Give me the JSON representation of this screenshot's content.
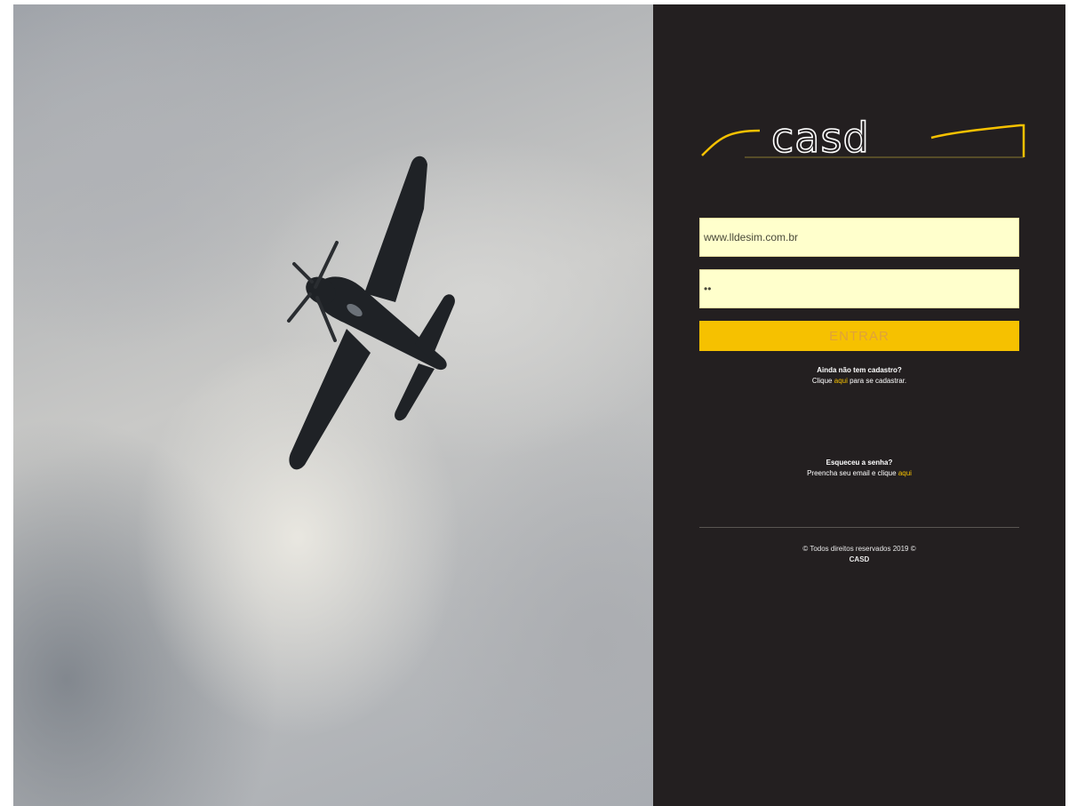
{
  "brand": {
    "logo_text": "casd",
    "accent_color": "#f6c100",
    "panel_color": "#231f20"
  },
  "login": {
    "email_value": "www.lldesim.com.br",
    "password_value": "••",
    "submit_label": "ENTRAR"
  },
  "signup": {
    "question": "Ainda não tem cadastro?",
    "prefix": "Clique",
    "link": "aqui",
    "suffix": "para se cadastrar."
  },
  "forgot": {
    "question": "Esqueceu a senha?",
    "prefix": "Preencha seu email e clique",
    "link": "aqui"
  },
  "footer": {
    "rights": "© Todos direitos reservados 2019 ©",
    "brand": "CASD"
  }
}
